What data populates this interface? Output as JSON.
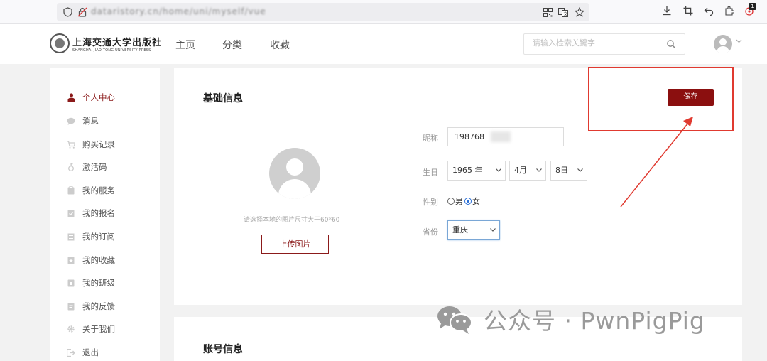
{
  "browser": {
    "url": "dataristory.cn/home/uni/myself/vue",
    "badge_count": "1"
  },
  "header": {
    "logo_cn": "上海交通大学出版社",
    "logo_en": "SHANGHAI JIAO TONG UNIVERSITY PRESS",
    "nav": [
      "主页",
      "分类",
      "收藏"
    ],
    "search_placeholder": "请输入检索关键字"
  },
  "sidebar": {
    "items": [
      {
        "label": "个人中心",
        "icon": "user-icon",
        "active": true
      },
      {
        "label": "消息",
        "icon": "chat-bubble-icon"
      },
      {
        "label": "购买记录",
        "icon": "cart-icon"
      },
      {
        "label": "激活码",
        "icon": "key-icon"
      },
      {
        "label": "我的服务",
        "icon": "clipboard-icon"
      },
      {
        "label": "我的报名",
        "icon": "clipboard-check-icon"
      },
      {
        "label": "我的订阅",
        "icon": "list-icon"
      },
      {
        "label": "我的收藏",
        "icon": "clipboard-star-icon"
      },
      {
        "label": "我的班级",
        "icon": "clipboard-class-icon"
      },
      {
        "label": "我的反馈",
        "icon": "feedback-icon"
      },
      {
        "label": "关于我们",
        "icon": "gear-icon"
      },
      {
        "label": "退出",
        "icon": "logout-icon"
      }
    ]
  },
  "profile": {
    "section_title": "基础信息",
    "save_label": "保存",
    "upload_hint": "请选择本地的图片尺寸大于60*60",
    "upload_label": "上传图片",
    "nickname_label": "昵称",
    "nickname_value": "198768",
    "birthday_label": "生日",
    "birth_year": "1965 年",
    "birth_month": "4月",
    "birth_day": "8日",
    "gender_label": "性别",
    "gender_male": "男",
    "gender_female": "女",
    "gender_selected": "女",
    "province_label": "省份",
    "province_value": "重庆"
  },
  "account": {
    "section_title": "账号信息"
  },
  "watermark": {
    "text": "公众号 · PwnPigPig"
  },
  "colors": {
    "brand": "#8b0f0f",
    "annotation": "#e03a30"
  }
}
